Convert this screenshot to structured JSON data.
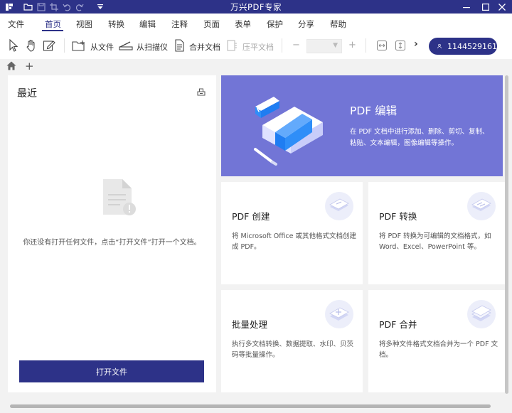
{
  "window": {
    "title": "万兴PDF专家"
  },
  "menu": {
    "items": [
      "文件",
      "首页",
      "视图",
      "转换",
      "编辑",
      "注释",
      "页面",
      "表单",
      "保护",
      "分享",
      "帮助"
    ],
    "active": "首页"
  },
  "toolbar": {
    "open_file": "从文件",
    "from_scanner": "从扫描仪",
    "merge": "合并文档",
    "flatten": "压平文档",
    "zoom_out": "−",
    "zoom_in": "+",
    "zoom_value": "",
    "more": "›",
    "account_id": "1144529161"
  },
  "tabs": {
    "new_tab": "+"
  },
  "recent": {
    "title": "最近",
    "empty_message": "你还没有打开任何文件，点击“打开文件”打开一个文档。",
    "open_button": "打开文件"
  },
  "hero": {
    "badge": "PDF",
    "title": "PDF 编辑",
    "description": "在 PDF 文档中进行添加、删除、剪切、复制、粘贴、文本编辑，图像编辑等操作。"
  },
  "cards": [
    {
      "title": "PDF 创建",
      "description": "将 Microsoft Office 或其他格式文档创建成 PDF。"
    },
    {
      "title": "PDF 转换",
      "description": "将 PDF 转换为可编辑的文档格式，如 Word、Excel、PowerPoint 等。"
    },
    {
      "title": "批量处理",
      "description": "执行多文档转换、数据提取、水印、贝茨码等批量操作。"
    },
    {
      "title": "PDF 合并",
      "description": "将多种文件格式文档合并为一个 PDF 文档。"
    }
  ],
  "colors": {
    "brand": "#2d3288",
    "hero_bg": "#7275d6",
    "background": "#f2f2f2"
  }
}
